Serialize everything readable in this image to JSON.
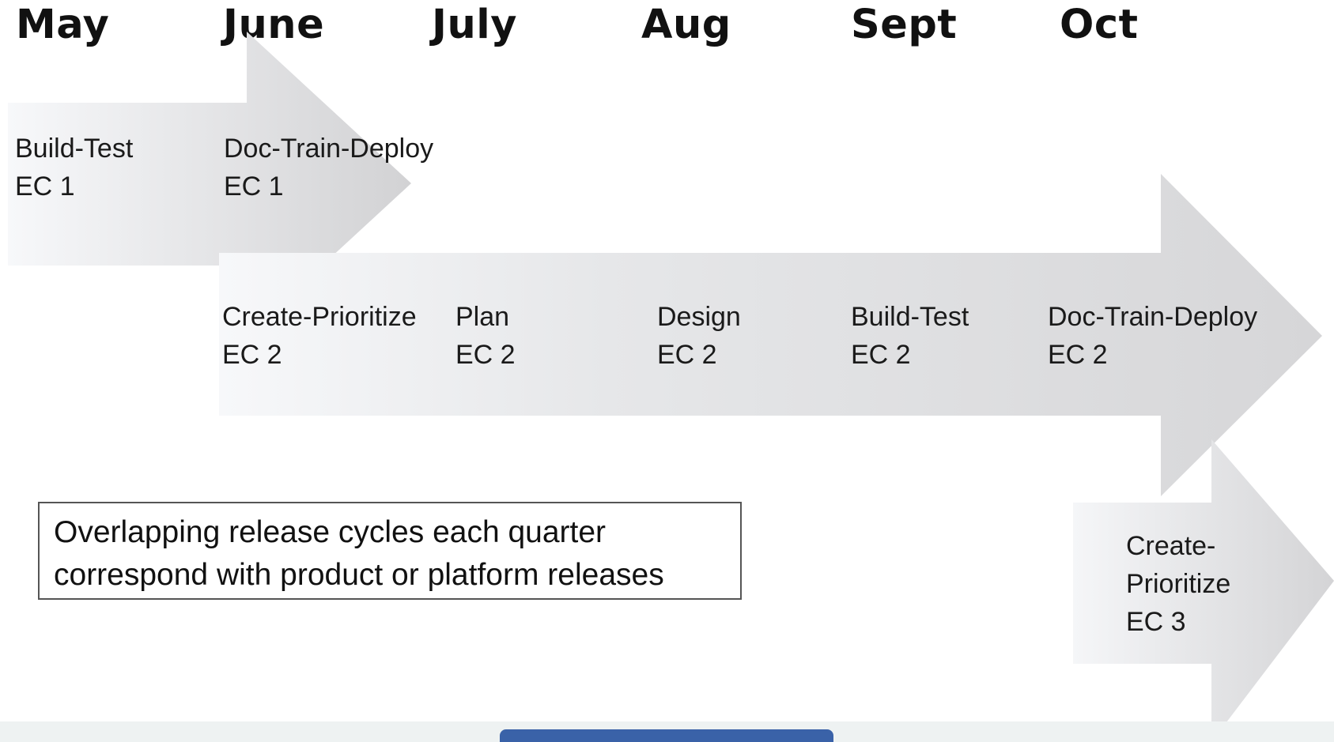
{
  "months": [
    "May",
    "June",
    "July",
    "Aug",
    "Sept",
    "Oct"
  ],
  "cycles": {
    "ec1": {
      "phases": [
        {
          "name": "Build-Test",
          "cycle": "EC 1"
        },
        {
          "name": "Doc-Train-Deploy",
          "cycle": "EC 1"
        }
      ]
    },
    "ec2": {
      "phases": [
        {
          "name": "Create-Prioritize",
          "cycle": "EC 2"
        },
        {
          "name": "Plan",
          "cycle": "EC 2"
        },
        {
          "name": "Design",
          "cycle": "EC 2"
        },
        {
          "name": "Build-Test",
          "cycle": "EC 2"
        },
        {
          "name": "Doc-Train-Deploy",
          "cycle": "EC 2"
        }
      ]
    },
    "ec3": {
      "phases": [
        {
          "name_line1": "Create-",
          "name_line2": "Prioritize",
          "cycle": "EC 3"
        }
      ]
    }
  },
  "note": {
    "line1": "Overlapping release cycles each quarter",
    "line2": "correspond with product or platform releases"
  },
  "colors": {
    "arrow_light": "#f7f8fa",
    "arrow_dark": "#d4d4d6",
    "note_border": "#555555",
    "footer_tab": "#3a62a8"
  }
}
